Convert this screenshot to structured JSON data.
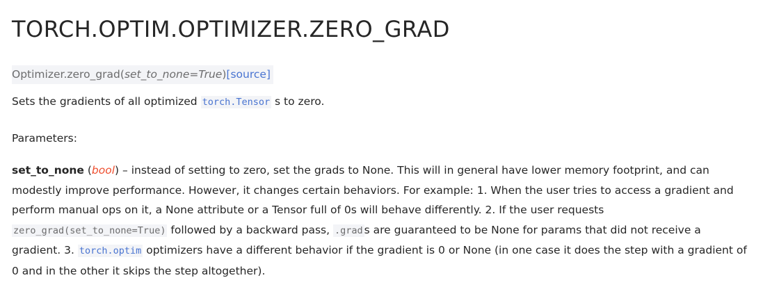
{
  "doc": {
    "title": "TORCH.OPTIM.OPTIMIZER.ZERO_GRAD",
    "signature": {
      "name": "Optimizer.zero_grad",
      "open_paren": "(",
      "param": "set_to_none=True",
      "close_paren": ")",
      "source_link": "[source]"
    },
    "description": {
      "before": "Sets the gradients of all optimized ",
      "code": "torch.Tensor",
      "after": " s to zero."
    },
    "parameters_label": "Parameters:",
    "param": {
      "name": "set_to_none",
      "type_open": " (",
      "type": "bool",
      "type_close": ")",
      "text1": " – instead of setting to zero, set the grads to None. This will in general have lower memory footprint, and can modestly improve performance. However, it changes certain behaviors. For example: 1. When the user tries to access a gradient and perform manual ops on it, a None attribute or a Tensor full of 0s will behave differently. 2. If the user requests ",
      "code1": "zero_grad(set_to_none=True)",
      "text2": " followed by a backward pass, ",
      "code2": ".grad",
      "text3": "s are guaranteed to be None for params that did not receive a gradient. 3. ",
      "code3": "torch.optim",
      "text4": " optimizers have a different behavior if the gradient is 0 or None (in one case it does the step with a gradient of 0 and in the other it skips the step altogether)."
    }
  }
}
